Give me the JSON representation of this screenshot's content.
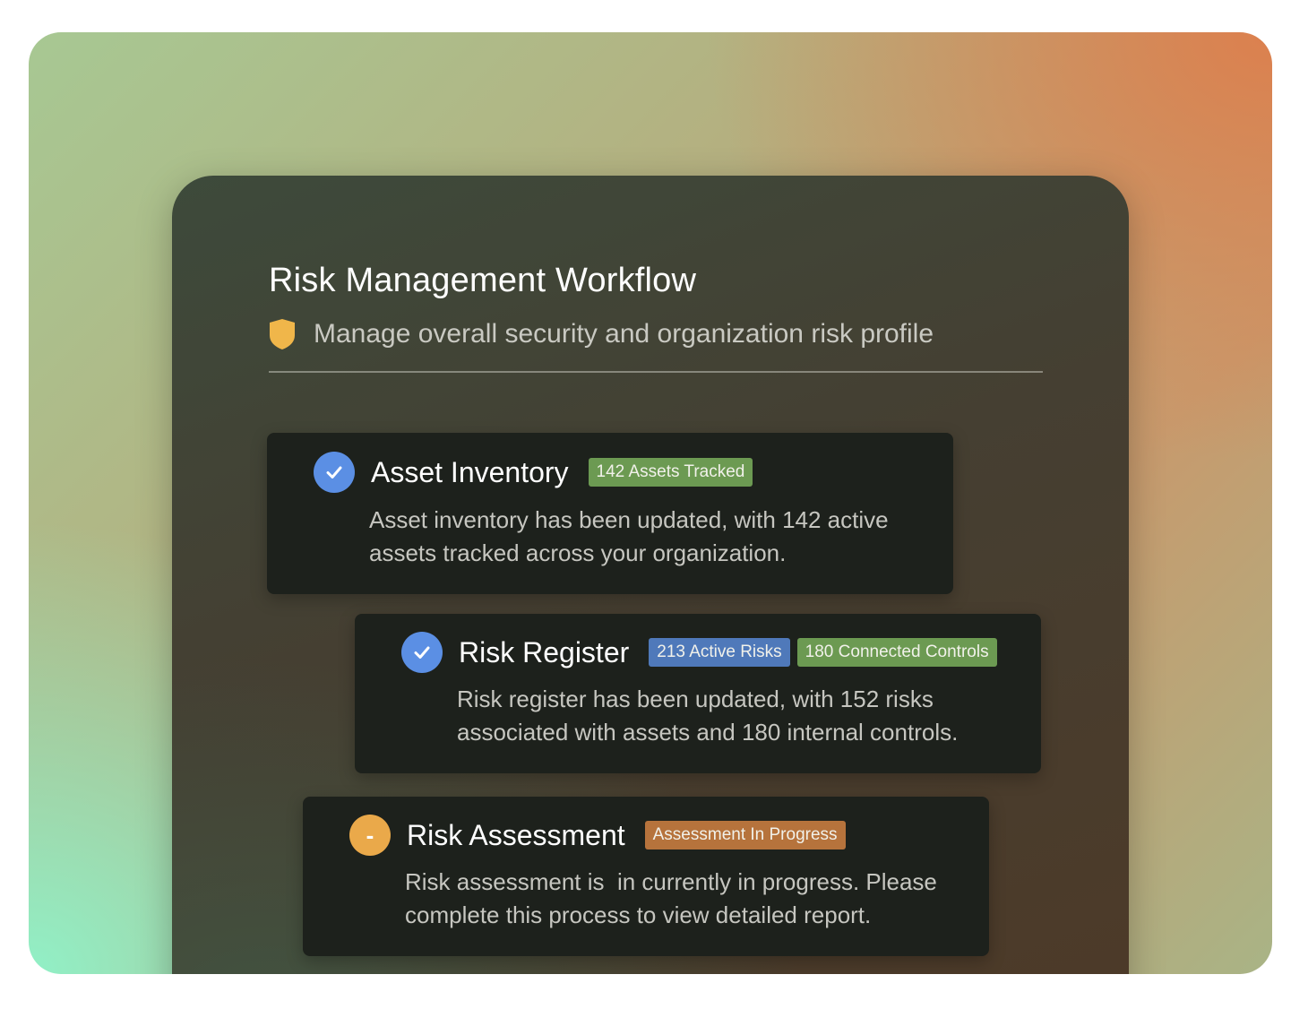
{
  "header": {
    "title": "Risk Management Workflow",
    "subtitle": "Manage overall security and organization risk profile",
    "icon": "shield-icon"
  },
  "colors": {
    "check": "#5b8fe4",
    "pending": "#eaa94a",
    "badge_green": "#6c9a52",
    "badge_blue": "#4f79ba",
    "badge_orange": "#b6733c"
  },
  "steps": [
    {
      "title": "Asset Inventory",
      "status": "complete",
      "status_icon": "check-icon",
      "badges": [
        "142 Assets Tracked"
      ],
      "description": "Asset inventory has been updated, with 142 active assets tracked across your organization."
    },
    {
      "title": "Risk Register",
      "status": "complete",
      "status_icon": "check-icon",
      "badges": [
        "213 Active Risks",
        "180 Connected Controls"
      ],
      "description": "Risk register has been updated, with 152 risks associated with assets and 180 internal controls."
    },
    {
      "title": "Risk Assessment",
      "status": "in-progress",
      "status_icon": "minus-icon",
      "status_symbol": "-",
      "badges": [
        "Assessment In Progress"
      ],
      "description": "Risk assessment is  in currently in progress. Please complete this process to view detailed report."
    }
  ]
}
